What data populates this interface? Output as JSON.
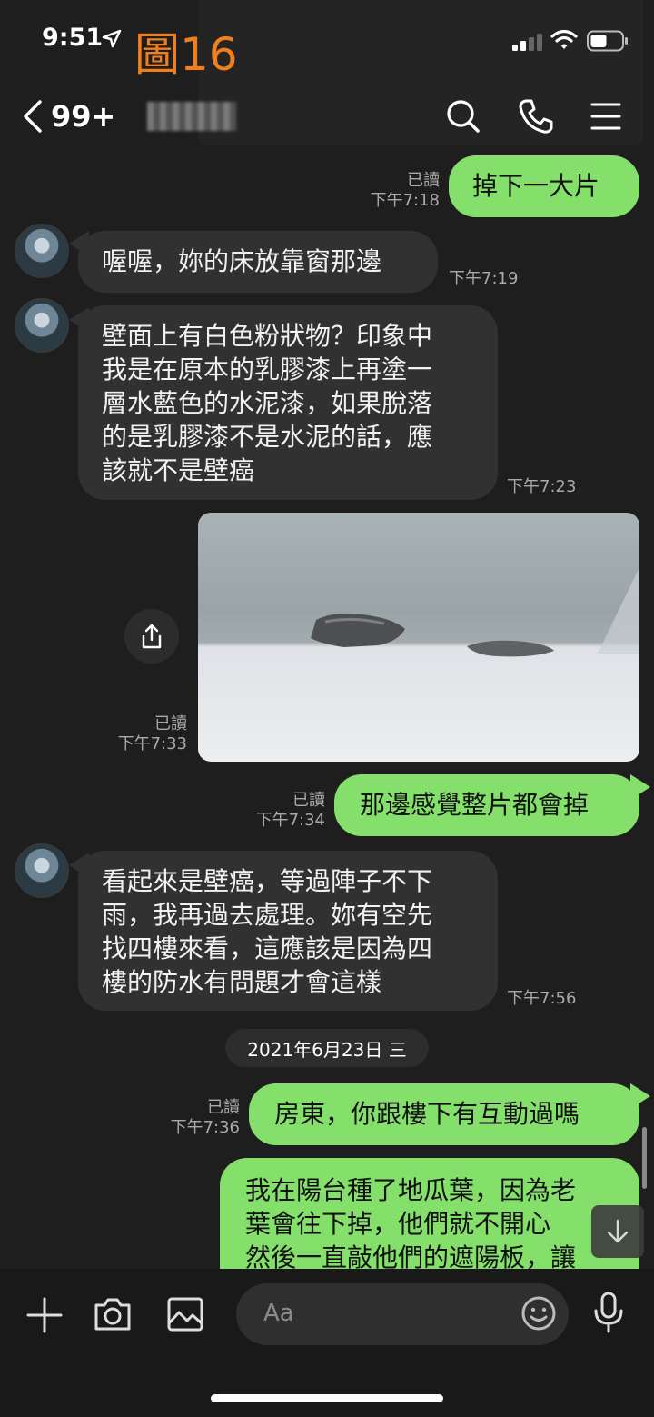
{
  "status": {
    "time": "9:51",
    "figure_label": "圖16"
  },
  "header": {
    "back_count": "99+"
  },
  "messages": {
    "m1": {
      "text": "掉下一大片",
      "read": "已讀",
      "time": "下午7:18"
    },
    "m2": {
      "text": "喔喔，妳的床放靠窗那邊",
      "time": "下午7:19"
    },
    "m3": {
      "lines": [
        "壁面上有白色粉狀物？印象中",
        "我是在原本的乳膠漆上再塗一",
        "層水藍色的水泥漆，如果脫落",
        "的是乳膠漆不是水泥的話，應",
        "該就不是壁癌"
      ],
      "time": "下午7:23"
    },
    "m4": {
      "read": "已讀",
      "time": "下午7:33"
    },
    "m5": {
      "text": "那邊感覺整片都會掉",
      "read": "已讀",
      "time": "下午7:34"
    },
    "m6": {
      "lines": [
        "看起來是壁癌，等過陣子不下",
        "雨，我再過去處理。妳有空先",
        "找四樓來看，這應該是因為四",
        "樓的防水有問題才會這樣"
      ],
      "time": "下午7:56"
    },
    "date": "2021年6月23日 三",
    "m7": {
      "text": "房東，你跟樓下有互動過嗎",
      "read": "已讀",
      "time": "下午7:36"
    },
    "m8": {
      "lines": [
        "我在陽台種了地瓜葉，因為老",
        "葉會往下掉，他們就不開心",
        "然後一直敲他們的遮陽板，讓"
      ]
    }
  },
  "composer": {
    "placeholder": "Aa"
  },
  "colors": {
    "outgoing": "#85e06b",
    "incoming": "#313131",
    "background": "#1e1e1e",
    "figure_label": "#f07f1d"
  }
}
